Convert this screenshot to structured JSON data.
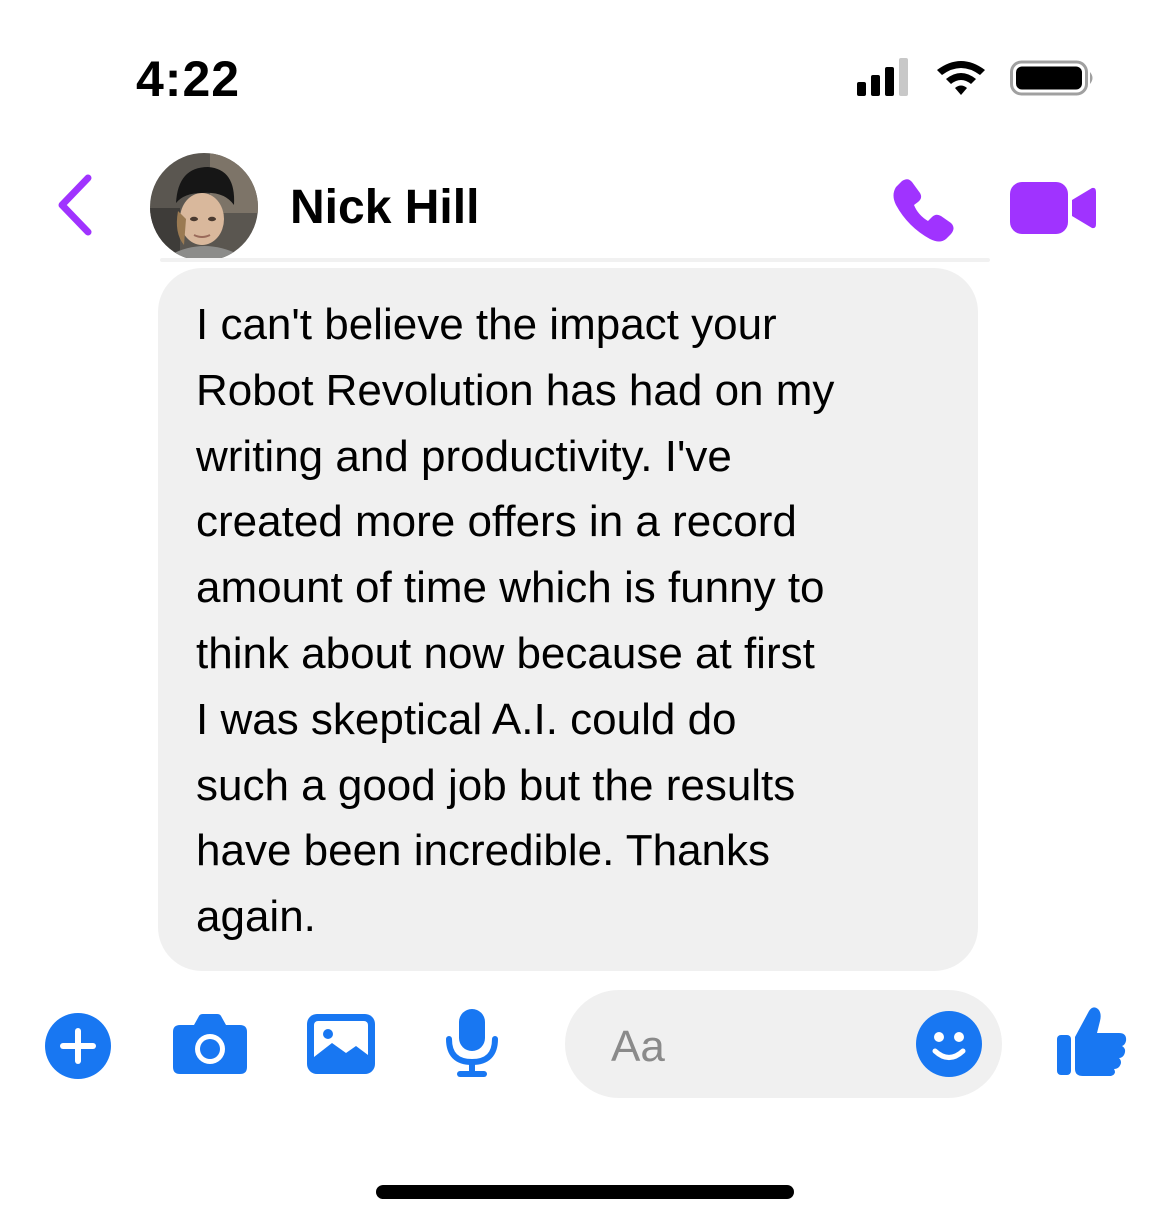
{
  "status_bar": {
    "time": "4:22",
    "icons": [
      "cellular-signal-icon",
      "wifi-icon",
      "battery-icon"
    ]
  },
  "header": {
    "contact_name": "Nick Hill",
    "icons": {
      "back": "chevron-left-icon",
      "call": "phone-icon",
      "video": "video-camera-icon"
    },
    "accent_color": "#a033ff"
  },
  "conversation": {
    "messages": [
      {
        "direction": "incoming",
        "lines": [
          "I can't believe the impact your",
          "Robot Revolution has had on my",
          "writing and productivity. I've",
          "created more offers in a record",
          "amount of time which is funny to",
          "think about now because at first",
          "I was skeptical A.I. could do",
          "such a good job but the results",
          "have been incredible. Thanks",
          "again."
        ],
        "bubble_color": "#f0f0f0"
      }
    ]
  },
  "composer": {
    "placeholder": "Aa",
    "icons": [
      "plus-icon",
      "camera-icon",
      "image-icon",
      "microphone-icon",
      "smiley-icon",
      "thumbs-up-icon"
    ],
    "accent_color": "#1877f2"
  }
}
